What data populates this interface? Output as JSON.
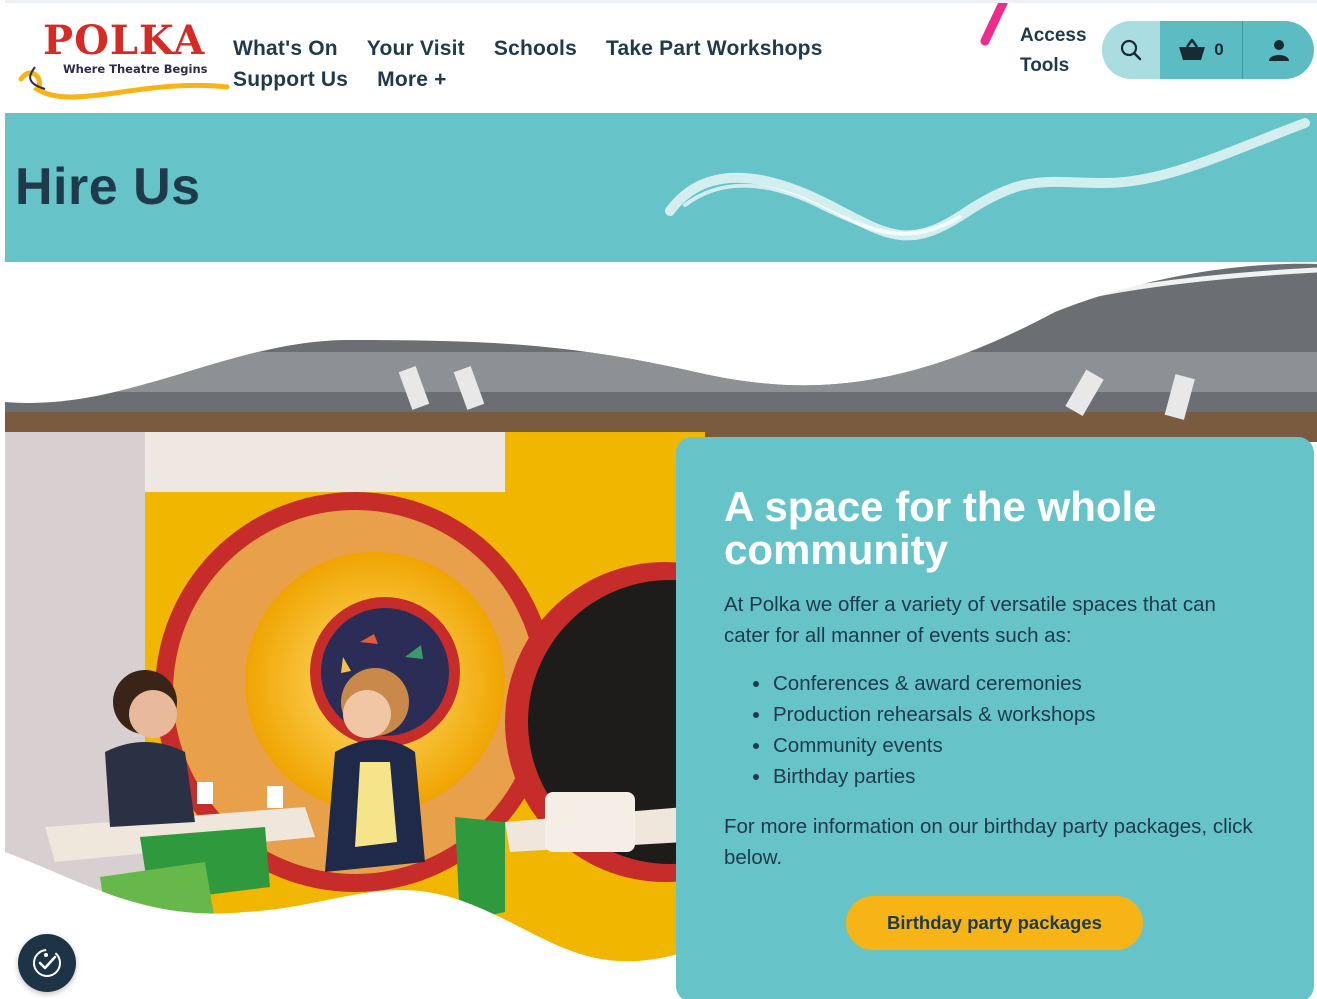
{
  "logo": {
    "word": "POLKA",
    "tagline": "Where Theatre Begins"
  },
  "nav": {
    "row1": [
      "What's On",
      "Your Visit",
      "Schools",
      "Take Part Workshops"
    ],
    "row2": [
      "Support Us",
      "More +"
    ]
  },
  "access": {
    "line1": "Access",
    "line2": "Tools"
  },
  "header_icons": {
    "search": "search-icon",
    "basket": "basket-icon",
    "basket_count": "0",
    "user": "user-icon"
  },
  "hero": {
    "title": "Hire Us"
  },
  "card": {
    "title": "A space for the whole community",
    "intro": "At Polka we offer a variety of versatile spaces that can cater for all manner of events such as:",
    "list": [
      "Conferences & award ceremonies",
      "Production rehearsals & workshops",
      "Community events",
      "Birthday parties"
    ],
    "more": "For more information on our birthday party packages, click below.",
    "cta": "Birthday party packages"
  },
  "colors": {
    "teal": "#66c3c8",
    "navy": "#1f3a4a",
    "yellow": "#f6b417",
    "brand_red": "#d62b25"
  }
}
